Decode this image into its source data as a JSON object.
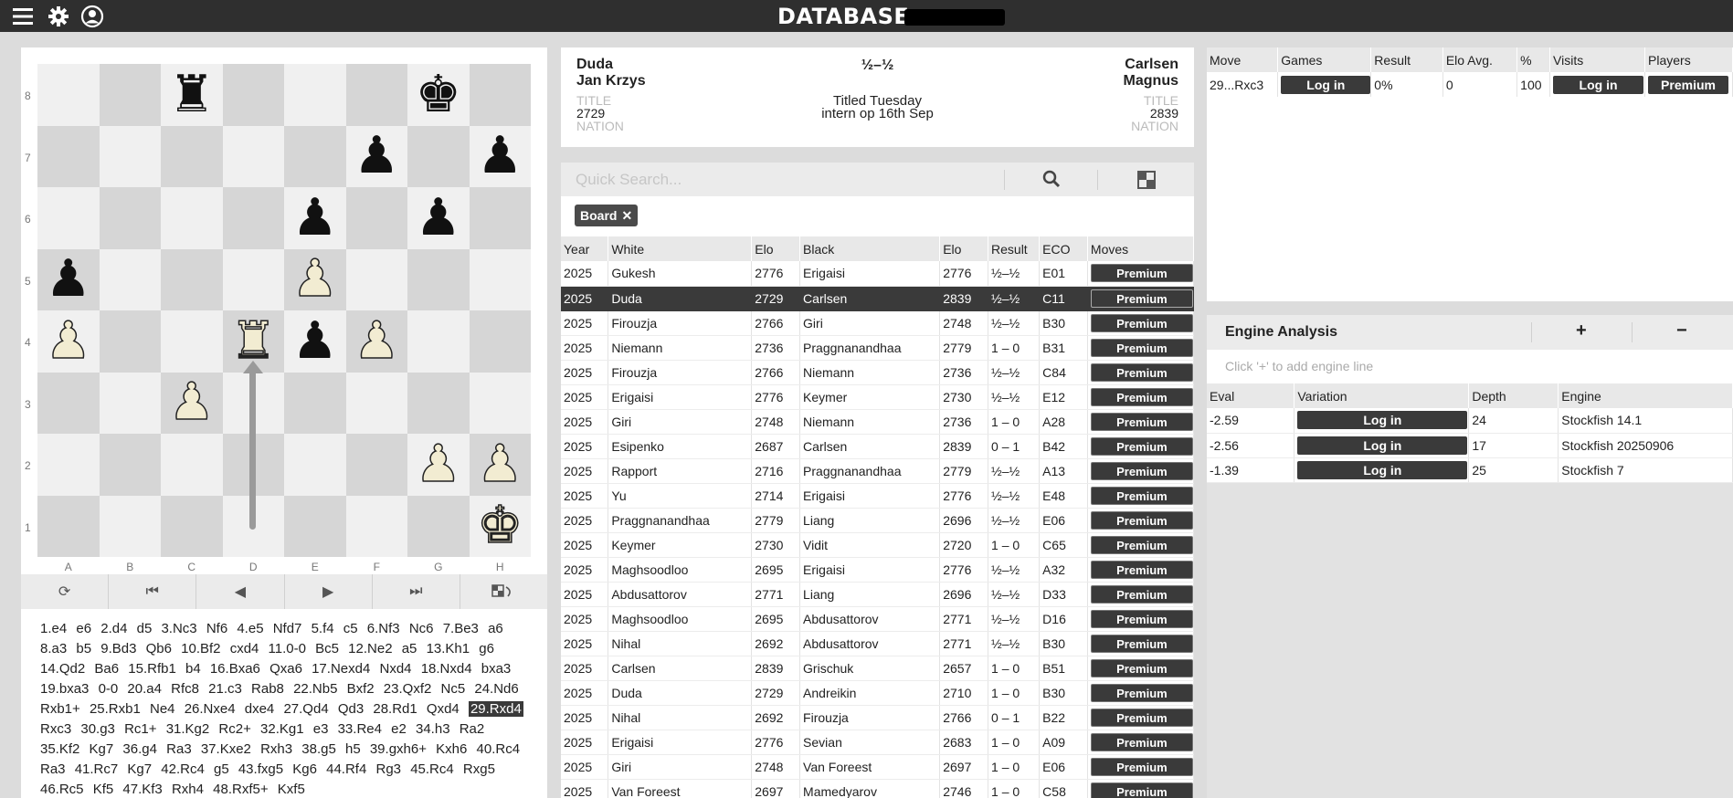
{
  "topbar": {
    "title": "DATABASE",
    "icons": [
      "menu-icon",
      "gear-icon",
      "user-icon"
    ]
  },
  "board": {
    "files": [
      "A",
      "B",
      "C",
      "D",
      "E",
      "F",
      "G",
      "H"
    ],
    "ranks": [
      "8",
      "7",
      "6",
      "5",
      "4",
      "3",
      "2",
      "1"
    ],
    "position": [
      [
        "",
        "",
        "r",
        "",
        "",
        "",
        "k",
        ""
      ],
      [
        "",
        "",
        "",
        "",
        "",
        "p",
        "",
        "p"
      ],
      [
        "",
        "",
        "",
        "",
        "p",
        "",
        "p",
        ""
      ],
      [
        "p",
        "",
        "",
        "",
        "P",
        "",
        "",
        ""
      ],
      [
        "P",
        "",
        "",
        "R",
        "p",
        "P",
        "",
        ""
      ],
      [
        "",
        "",
        "P",
        "",
        "",
        "",
        "",
        ""
      ],
      [
        "",
        "",
        "",
        "",
        "",
        "",
        "P",
        "P"
      ],
      [
        "",
        "",
        "",
        "",
        "",
        "",
        "",
        "K"
      ]
    ],
    "arrow": {
      "from": "d1",
      "to": "d4"
    }
  },
  "controls": [
    "flip-icon",
    "first-icon",
    "prev-icon",
    "next-icon",
    "last-icon",
    "board-settings-icon"
  ],
  "moves": [
    "1.e4",
    "e6",
    "2.d4",
    "d5",
    "3.Nc3",
    "Nf6",
    "4.e5",
    "Nfd7",
    "5.f4",
    "c5",
    "6.Nf3",
    "Nc6",
    "7.Be3",
    "a6",
    "8.a3",
    "b5",
    "9.Bd3",
    "Qb6",
    "10.Bf2",
    "cxd4",
    "11.0-0",
    "Bc5",
    "12.Ne2",
    "a5",
    "13.Kh1",
    "g6",
    "14.Qd2",
    "Ba6",
    "15.Rfb1",
    "b4",
    "16.Bxa6",
    "Qxa6",
    "17.Nexd4",
    "Nxd4",
    "18.Nxd4",
    "bxa3",
    "19.bxa3",
    "0-0",
    "20.a4",
    "Rfc8",
    "21.c3",
    "Rab8",
    "22.Nb5",
    "Bxf2",
    "23.Qxf2",
    "Nc5",
    "24.Nd6",
    "Rxb1+",
    "25.Rxb1",
    "Ne4",
    "26.Nxe4",
    "dxe4",
    "27.Qd4",
    "Qd3",
    "28.Rd1",
    "Qxd4",
    "29.Rxd4",
    "Rxc3",
    "30.g3",
    "Rc1+",
    "31.Kg2",
    "Rc2+",
    "32.Kg1",
    "e3",
    "33.Re4",
    "e2",
    "34.h3",
    "Ra2",
    "35.Kf2",
    "Kg7",
    "36.g4",
    "Ra3",
    "37.Kxe2",
    "Rxh3",
    "38.g5",
    "h5",
    "39.gxh6+",
    "Kxh6",
    "40.Rc4",
    "Ra3",
    "41.Rc7",
    "Kg7",
    "42.Rc4",
    "g5",
    "43.fxg5",
    "Kg6",
    "44.Rf4",
    "Rg3",
    "45.Rc4",
    "Rxg5",
    "46.Rc5",
    "Kf5",
    "47.Kf3",
    "Rxh4",
    "48.Rxf5+",
    "Kxf5"
  ],
  "current_move_index": 56,
  "game": {
    "white_surname": "Duda",
    "white_first": "Jan Krzys",
    "white_title_label": "TITLE",
    "white_elo": "2729",
    "white_nation_label": "NATION",
    "result": "½–½",
    "event": "Titled Tuesday",
    "event_sub": "intern op 16th Sep",
    "black_surname": "Carlsen",
    "black_first": "Magnus",
    "black_title_label": "TITLE",
    "black_elo": "2839",
    "black_nation_label": "NATION"
  },
  "search": {
    "placeholder": "Quick Search...",
    "filter_label": "Board",
    "filter_close": "✕"
  },
  "games_table": {
    "columns": [
      "Year",
      "White",
      "Elo",
      "Black",
      "Elo",
      "Result",
      "ECO",
      "Moves"
    ],
    "premium_label": "Premium",
    "selected_index": 1,
    "rows": [
      [
        "2025",
        "Gukesh",
        "2776",
        "Erigaisi",
        "2776",
        "½–½",
        "E01"
      ],
      [
        "2025",
        "Duda",
        "2729",
        "Carlsen",
        "2839",
        "½–½",
        "C11"
      ],
      [
        "2025",
        "Firouzja",
        "2766",
        "Giri",
        "2748",
        "½–½",
        "B30"
      ],
      [
        "2025",
        "Niemann",
        "2736",
        "Praggnanandhaa",
        "2779",
        "1 – 0",
        "B31"
      ],
      [
        "2025",
        "Firouzja",
        "2766",
        "Niemann",
        "2736",
        "½–½",
        "C84"
      ],
      [
        "2025",
        "Erigaisi",
        "2776",
        "Keymer",
        "2730",
        "½–½",
        "E12"
      ],
      [
        "2025",
        "Giri",
        "2748",
        "Niemann",
        "2736",
        "1 – 0",
        "A28"
      ],
      [
        "2025",
        "Esipenko",
        "2687",
        "Carlsen",
        "2839",
        "0 – 1",
        "B42"
      ],
      [
        "2025",
        "Rapport",
        "2716",
        "Praggnanandhaa",
        "2779",
        "½–½",
        "A13"
      ],
      [
        "2025",
        "Yu",
        "2714",
        "Erigaisi",
        "2776",
        "½–½",
        "E48"
      ],
      [
        "2025",
        "Praggnanandhaa",
        "2779",
        "Liang",
        "2696",
        "½–½",
        "E06"
      ],
      [
        "2025",
        "Keymer",
        "2730",
        "Vidit",
        "2720",
        "1 – 0",
        "C65"
      ],
      [
        "2025",
        "Maghsoodloo",
        "2695",
        "Erigaisi",
        "2776",
        "½–½",
        "A32"
      ],
      [
        "2025",
        "Abdusattorov",
        "2771",
        "Liang",
        "2696",
        "½–½",
        "D33"
      ],
      [
        "2025",
        "Maghsoodloo",
        "2695",
        "Abdusattorov",
        "2771",
        "½–½",
        "D16"
      ],
      [
        "2025",
        "Nihal",
        "2692",
        "Abdusattorov",
        "2771",
        "½–½",
        "B30"
      ],
      [
        "2025",
        "Carlsen",
        "2839",
        "Grischuk",
        "2657",
        "1 – 0",
        "B51"
      ],
      [
        "2025",
        "Duda",
        "2729",
        "Andreikin",
        "2710",
        "1 – 0",
        "B30"
      ],
      [
        "2025",
        "Nihal",
        "2692",
        "Firouzja",
        "2766",
        "0 – 1",
        "B22"
      ],
      [
        "2025",
        "Erigaisi",
        "2776",
        "Sevian",
        "2683",
        "1 – 0",
        "A09"
      ],
      [
        "2025",
        "Giri",
        "2748",
        "Van Foreest",
        "2697",
        "1 – 0",
        "E06"
      ],
      [
        "2025",
        "Van Foreest",
        "2697",
        "Mamedyarov",
        "2746",
        "1 – 0",
        "C58"
      ]
    ]
  },
  "moves_table": {
    "columns": [
      "Move",
      "Games",
      "Result",
      "Elo Avg.",
      "%",
      "Visits",
      "Players"
    ],
    "row": {
      "move": "29...Rxc3",
      "games": "Log in",
      "result": "0%",
      "elo_avg": "0",
      "percent": "100",
      "visits": "Log in",
      "players": "Premium"
    }
  },
  "engine": {
    "title": "Engine Analysis",
    "add": "+",
    "remove": "−",
    "hint": "Click '+' to add engine line",
    "columns": [
      "Eval",
      "Variation",
      "Depth",
      "Engine"
    ],
    "login_label": "Log in",
    "rows": [
      {
        "eval": "-2.59",
        "depth": "24",
        "engine": "Stockfish 14.1"
      },
      {
        "eval": "-2.56",
        "depth": "17",
        "engine": "Stockfish 20250906"
      },
      {
        "eval": "-1.39",
        "depth": "25",
        "engine": "Stockfish 7"
      }
    ]
  }
}
